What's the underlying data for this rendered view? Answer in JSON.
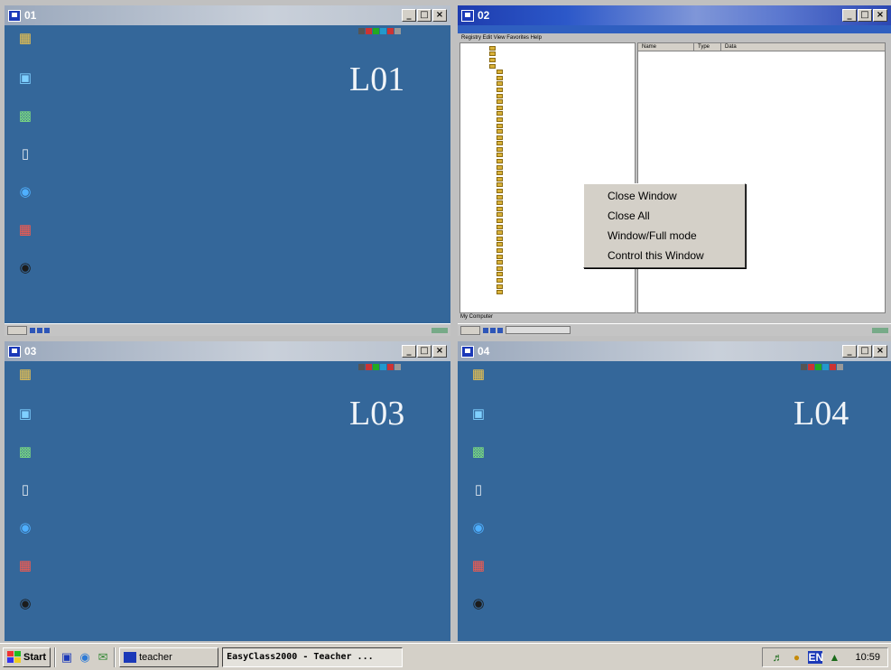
{
  "panes": [
    {
      "id": "01",
      "title": "01",
      "label": "L01",
      "active": false
    },
    {
      "id": "02",
      "title": "02",
      "label": "",
      "active": true
    },
    {
      "id": "03",
      "title": "03",
      "label": "L03",
      "active": false
    },
    {
      "id": "04",
      "title": "04",
      "label": "L04",
      "active": false
    }
  ],
  "window_buttons": {
    "minimize": "_",
    "maximize": "□",
    "close": "×"
  },
  "registry": {
    "menu": "Registry  Edit  View  Favorites  Help",
    "list_headers": [
      "Name",
      "Type",
      "Data"
    ],
    "status": "My Computer"
  },
  "context_menu": {
    "items": [
      "Close Window",
      "Close All",
      "Window/Full mode",
      "Control this Window"
    ]
  },
  "taskbar": {
    "start_label": "Start",
    "teacher_label": "teacher",
    "app_label": "EasyClass2000 - Teacher ...",
    "tray_lang": "EN",
    "clock": "10:59"
  },
  "colors": {
    "desktop": "#34679a",
    "active_title": "#2c58c9",
    "inactive_title": "#b7c0cc"
  }
}
